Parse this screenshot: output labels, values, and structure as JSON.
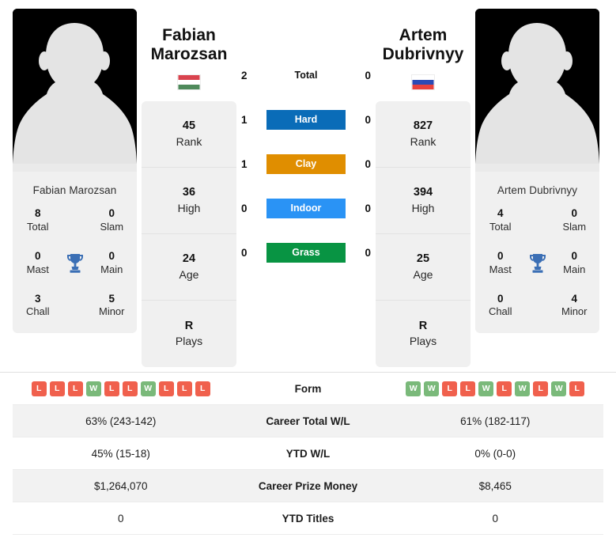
{
  "players": {
    "left": {
      "first_name": "Fabian",
      "last_name": "Marozsan",
      "full_name": "Fabian Marozsan",
      "flag_icon": "hungary-flag-icon",
      "flag_colors": [
        "#d9434e",
        "#ffffff",
        "#4f8a5b"
      ],
      "rank": "45",
      "rank_label": "Rank",
      "high": "36",
      "high_label": "High",
      "age": "24",
      "age_label": "Age",
      "plays": "R",
      "plays_label": "Plays",
      "titles": {
        "total": "8",
        "total_label": "Total",
        "slam": "0",
        "slam_label": "Slam",
        "mast": "0",
        "mast_label": "Mast",
        "main": "0",
        "main_label": "Main",
        "chall": "3",
        "chall_label": "Chall",
        "minor": "5",
        "minor_label": "Minor"
      },
      "form": [
        "L",
        "L",
        "L",
        "W",
        "L",
        "L",
        "W",
        "L",
        "L",
        "L"
      ],
      "career_wl": "63% (243-142)",
      "ytd_wl": "45% (15-18)",
      "career_prize": "$1,264,070",
      "ytd_titles": "0"
    },
    "right": {
      "first_name": "Artem",
      "last_name": "Dubrivnyy",
      "full_name": "Artem Dubrivnyy",
      "flag_icon": "russia-flag-icon",
      "flag_colors": [
        "#ffffff",
        "#2b4ab5",
        "#e8413c"
      ],
      "rank": "827",
      "rank_label": "Rank",
      "high": "394",
      "high_label": "High",
      "age": "25",
      "age_label": "Age",
      "plays": "R",
      "plays_label": "Plays",
      "titles": {
        "total": "4",
        "total_label": "Total",
        "slam": "0",
        "slam_label": "Slam",
        "mast": "0",
        "mast_label": "Mast",
        "main": "0",
        "main_label": "Main",
        "chall": "0",
        "chall_label": "Chall",
        "minor": "4",
        "minor_label": "Minor"
      },
      "form": [
        "W",
        "W",
        "L",
        "L",
        "W",
        "L",
        "W",
        "L",
        "W",
        "L"
      ],
      "career_wl": "61% (182-117)",
      "ytd_wl": "0% (0-0)",
      "career_prize": "$8,465",
      "ytd_titles": "0"
    }
  },
  "h2h": {
    "rows": [
      {
        "label": "Total",
        "left": "2",
        "right": "0",
        "color": "transparent",
        "text_color": "#111111"
      },
      {
        "label": "Hard",
        "left": "1",
        "right": "0",
        "color": "#0a6cb8",
        "text_color": "#ffffff"
      },
      {
        "label": "Clay",
        "left": "1",
        "right": "0",
        "color": "#e08e00",
        "text_color": "#ffffff"
      },
      {
        "label": "Indoor",
        "left": "0",
        "right": "0",
        "color": "#2a93f5",
        "text_color": "#ffffff"
      },
      {
        "label": "Grass",
        "left": "0",
        "right": "0",
        "color": "#089443",
        "text_color": "#ffffff"
      }
    ]
  },
  "table": {
    "rows": [
      {
        "label": "Form",
        "type": "form"
      },
      {
        "label": "Career Total W/L",
        "type": "text",
        "key": "career_wl"
      },
      {
        "label": "YTD W/L",
        "type": "text",
        "key": "ytd_wl"
      },
      {
        "label": "Career Prize Money",
        "type": "text",
        "key": "career_prize"
      },
      {
        "label": "YTD Titles",
        "type": "text",
        "key": "ytd_titles"
      }
    ]
  },
  "colors": {
    "win_badge": "#7ab97a",
    "loss_badge": "#f0604d",
    "card_bg": "#f0f0f0",
    "trophy": "#3b6fb5",
    "alt_row": "#f2f2f2"
  },
  "icons": {
    "trophy": "trophy-icon",
    "avatar": "avatar-placeholder-icon"
  }
}
